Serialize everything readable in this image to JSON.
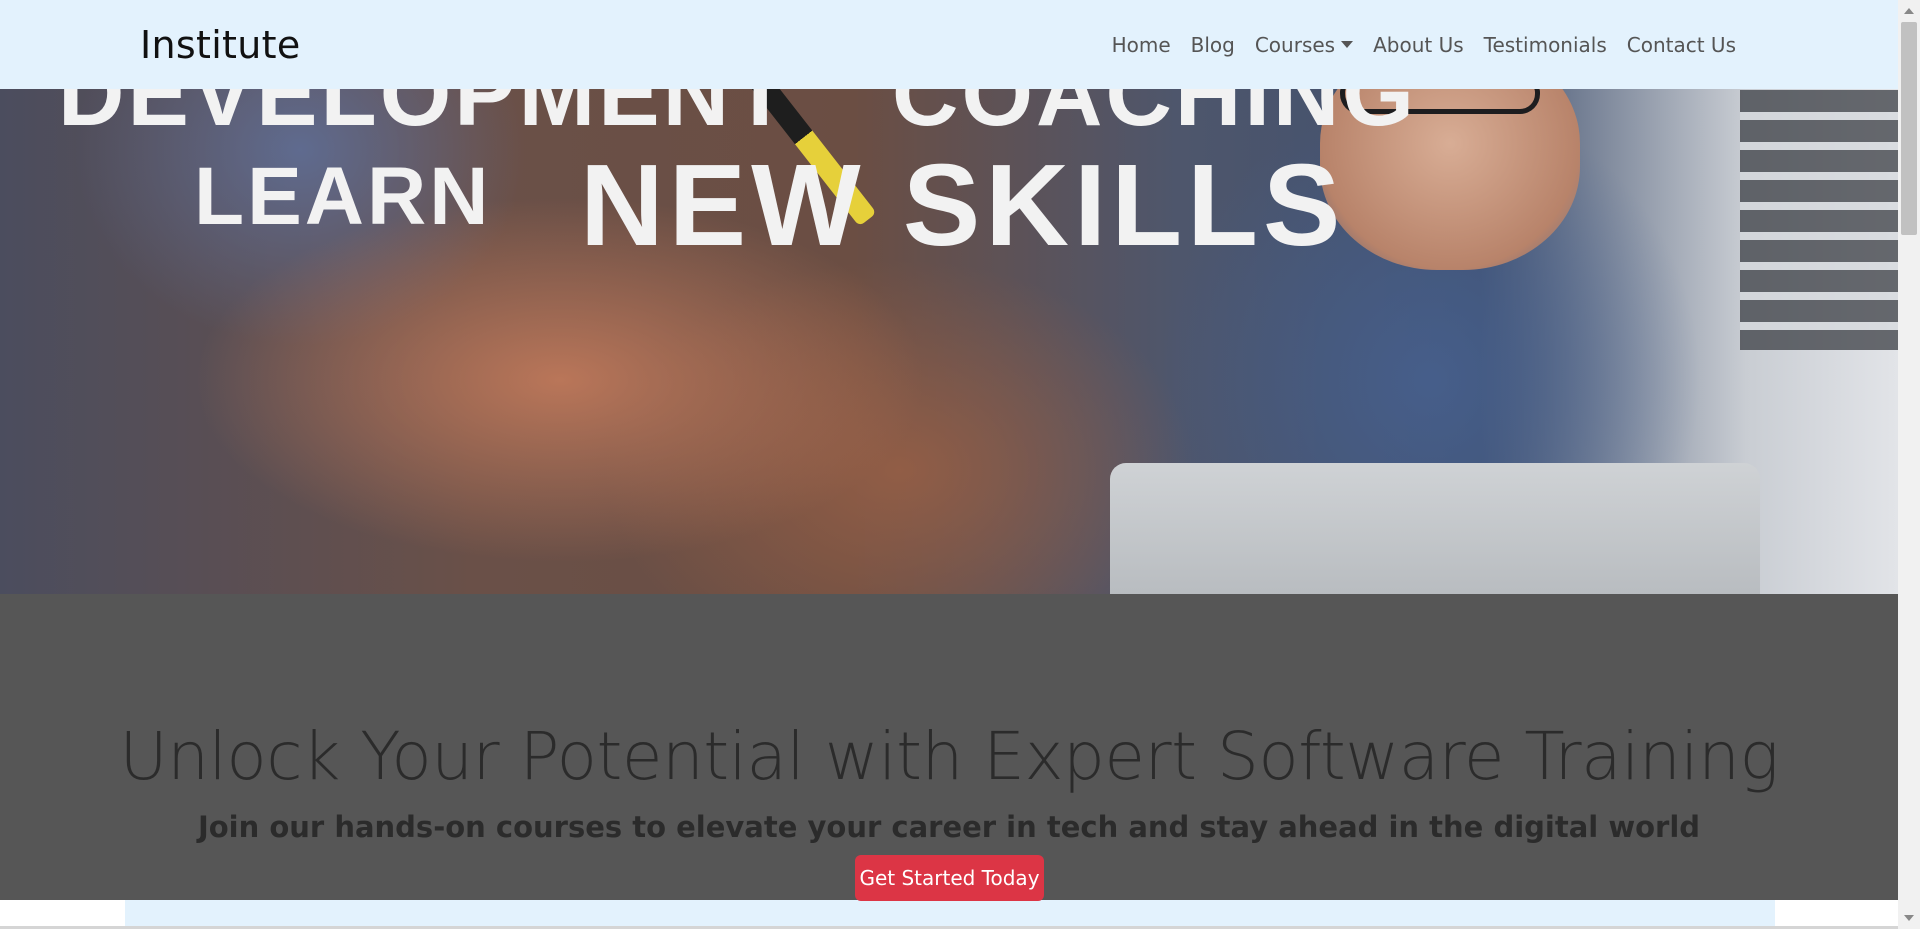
{
  "brand": {
    "name": "Institute"
  },
  "nav": {
    "items": [
      {
        "label": "Home"
      },
      {
        "label": "Blog"
      },
      {
        "label": "Courses"
      },
      {
        "label": "About Us"
      },
      {
        "label": "Testimonials"
      },
      {
        "label": "Contact Us"
      }
    ]
  },
  "hero": {
    "line1_left": "DEVELOPMENT",
    "line1_right": "COACHING",
    "line2_left": "LEARN",
    "line2_right": "NEW SKILLS"
  },
  "promo": {
    "title": "Unlock Your Potential with Expert Software Training",
    "subtitle": "Join our hands-on courses to elevate your career in tech and stay ahead in the digital world",
    "cta_label": "Get Started Today"
  },
  "icons": {
    "courses_dropdown": "caret-down-icon",
    "scroll_up": "scroll-up-icon",
    "scroll_down": "scroll-down-icon"
  },
  "colors": {
    "navbar_bg": "#e3f2fd",
    "promo_bg": "#565656",
    "cta_bg": "#dc3545"
  }
}
